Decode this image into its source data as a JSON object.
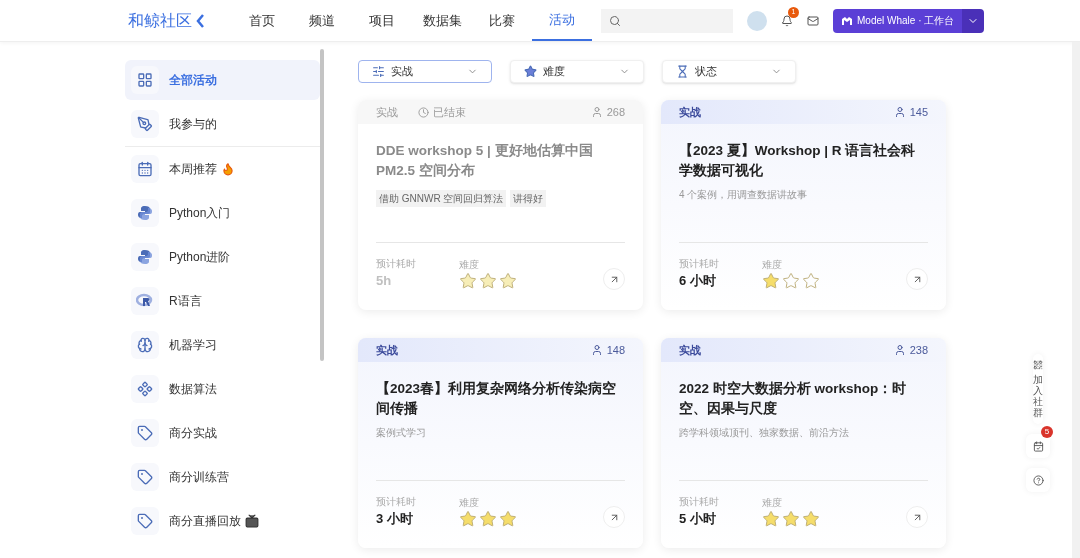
{
  "header": {
    "logo": "和鲸社区",
    "nav": [
      {
        "label": "首页",
        "selected": false
      },
      {
        "label": "频道",
        "selected": false
      },
      {
        "label": "项目",
        "selected": false
      },
      {
        "label": "数据集",
        "selected": false
      },
      {
        "label": "比赛",
        "selected": false
      },
      {
        "label": "活动",
        "selected": true
      }
    ],
    "notification_count": "1",
    "workbench_button": "Model Whale · 工作台"
  },
  "sidebar": {
    "items": [
      {
        "label": "全部活动",
        "selected": true
      },
      {
        "label": "我参与的",
        "selected": false,
        "divider_after": true
      },
      {
        "label": "本周推荐",
        "selected": false,
        "badge": {
          "kind": "fire"
        }
      },
      {
        "label": "Python入门",
        "selected": false
      },
      {
        "label": "Python进阶",
        "selected": false
      },
      {
        "label": "R语言",
        "selected": false
      },
      {
        "label": "机器学习",
        "selected": false
      },
      {
        "label": "数据算法",
        "selected": false
      },
      {
        "label": "商分实战",
        "selected": false
      },
      {
        "label": "商分训练营",
        "selected": false
      },
      {
        "label": "商分直播回放",
        "selected": false,
        "badge": {
          "kind": "tv"
        }
      }
    ]
  },
  "filters": [
    {
      "value": "实战",
      "selected": true
    },
    {
      "value": "难度",
      "selected": false
    },
    {
      "value": "状态",
      "selected": false
    }
  ],
  "cards": [
    {
      "tag": "实战",
      "status": "已结束",
      "ended": true,
      "participants": "268",
      "title": "DDE workshop 5 | 更好地估算中国 PM2.5 空间分布",
      "tags": [
        "借助 GNNWR 空间回归算法",
        "讲得好"
      ],
      "time_label": "预计耗时",
      "time": "5h",
      "difficulty_label": "难度",
      "stars": 3
    },
    {
      "tag": "实战",
      "ended": false,
      "participants": "145",
      "title": "【2023 夏】Workshop | R 语言社会科学数据可视化",
      "subtitle": "4 个案例，用调查数据讲故事",
      "time_label": "预计耗时",
      "time": "6 小时",
      "difficulty_label": "难度",
      "stars": 1
    },
    {
      "tag": "实战",
      "ended": false,
      "participants": "148",
      "title": "【2023春】利用复杂网络分析传染病空间传播",
      "subtitle": "案例式学习",
      "time_label": "预计耗时",
      "time": "3 小时",
      "difficulty_label": "难度",
      "stars": 3
    },
    {
      "tag": "实战",
      "ended": false,
      "participants": "238",
      "title": "2022 时空大数据分析 workshop：时空、因果与尺度",
      "subtitle": "跨学科领域顶刊、独家数据、前沿方法",
      "time_label": "预计耗时",
      "time": "5 小时",
      "difficulty_label": "难度",
      "stars": 3
    }
  ],
  "side_panel": {
    "join_label": "加入社群",
    "calendar_count": "5"
  }
}
